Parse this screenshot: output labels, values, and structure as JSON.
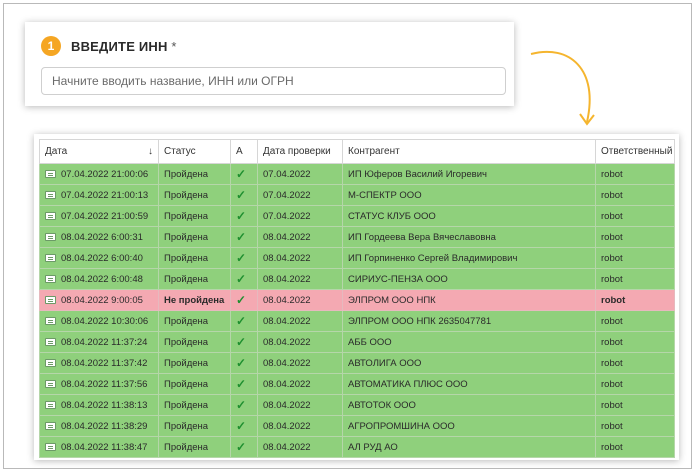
{
  "inn_section": {
    "step_number": "1",
    "title": "ВВЕДИТЕ ИНН",
    "required_mark": "*",
    "search_placeholder": "Начните вводить название, ИНН или ОГРН",
    "search_value": ""
  },
  "table": {
    "columns": [
      "Дата",
      "Статус",
      "А",
      "Дата проверки",
      "Контрагент",
      "Ответственный"
    ],
    "sort_indicator": "↓",
    "rows": [
      {
        "date": "07.04.2022 21:00:06",
        "status": "Пройдена",
        "a": "✓",
        "check_date": "07.04.2022",
        "counterparty": "ИП Юферов Василий Игоревич",
        "responsible": "robot",
        "state": "ok"
      },
      {
        "date": "07.04.2022 21:00:13",
        "status": "Пройдена",
        "a": "✓",
        "check_date": "07.04.2022",
        "counterparty": "М-СПЕКТР ООО",
        "responsible": "robot",
        "state": "ok"
      },
      {
        "date": "07.04.2022 21:00:59",
        "status": "Пройдена",
        "a": "✓",
        "check_date": "07.04.2022",
        "counterparty": "СТАТУС КЛУБ ООО",
        "responsible": "robot",
        "state": "ok"
      },
      {
        "date": "08.04.2022 6:00:31",
        "status": "Пройдена",
        "a": "✓",
        "check_date": "08.04.2022",
        "counterparty": "ИП Гордеева Вера Вячеславовна",
        "responsible": "robot",
        "state": "ok"
      },
      {
        "date": "08.04.2022 6:00:40",
        "status": "Пройдена",
        "a": "✓",
        "check_date": "08.04.2022",
        "counterparty": "ИП Горпиненко Сергей Владимирович",
        "responsible": "robot",
        "state": "ok"
      },
      {
        "date": "08.04.2022 6:00:48",
        "status": "Пройдена",
        "a": "✓",
        "check_date": "08.04.2022",
        "counterparty": "СИРИУС-ПЕНЗА ООО",
        "responsible": "robot",
        "state": "ok"
      },
      {
        "date": "08.04.2022 9:00:05",
        "status": "Не пройдена",
        "a": "✓",
        "check_date": "08.04.2022",
        "counterparty": "ЭЛПРОМ ООО НПК",
        "responsible": "robot",
        "state": "fail"
      },
      {
        "date": "08.04.2022 10:30:06",
        "status": "Пройдена",
        "a": "✓",
        "check_date": "08.04.2022",
        "counterparty": "ЭЛПРОМ ООО НПК 2635047781",
        "responsible": "robot",
        "state": "ok"
      },
      {
        "date": "08.04.2022 11:37:24",
        "status": "Пройдена",
        "a": "✓",
        "check_date": "08.04.2022",
        "counterparty": "АББ ООО",
        "responsible": "robot",
        "state": "ok"
      },
      {
        "date": "08.04.2022 11:37:42",
        "status": "Пройдена",
        "a": "✓",
        "check_date": "08.04.2022",
        "counterparty": "АВТОЛИГА ООО",
        "responsible": "robot",
        "state": "ok"
      },
      {
        "date": "08.04.2022 11:37:56",
        "status": "Пройдена",
        "a": "✓",
        "check_date": "08.04.2022",
        "counterparty": "АВТОМАТИКА ПЛЮС ООО",
        "responsible": "robot",
        "state": "ok"
      },
      {
        "date": "08.04.2022 11:38:13",
        "status": "Пройдена",
        "a": "✓",
        "check_date": "08.04.2022",
        "counterparty": "АВТОТОК ООО",
        "responsible": "robot",
        "state": "ok"
      },
      {
        "date": "08.04.2022 11:38:29",
        "status": "Пройдена",
        "a": "✓",
        "check_date": "08.04.2022",
        "counterparty": "АГРОПРОМШИНА ООО",
        "responsible": "robot",
        "state": "ok"
      },
      {
        "date": "08.04.2022 11:38:47",
        "status": "Пройдена",
        "a": "✓",
        "check_date": "08.04.2022",
        "counterparty": "АЛ РУД АО",
        "responsible": "robot",
        "state": "ok"
      }
    ]
  },
  "icons": {
    "row_icon": "document-icon",
    "check_icon": "checkmark-icon",
    "arrow": "curved-arrow-icon"
  },
  "colors": {
    "accent": "#f5a623",
    "row_ok": "#8fd07c",
    "row_fail": "#f4a9b2",
    "check": "#1e8f2f"
  }
}
